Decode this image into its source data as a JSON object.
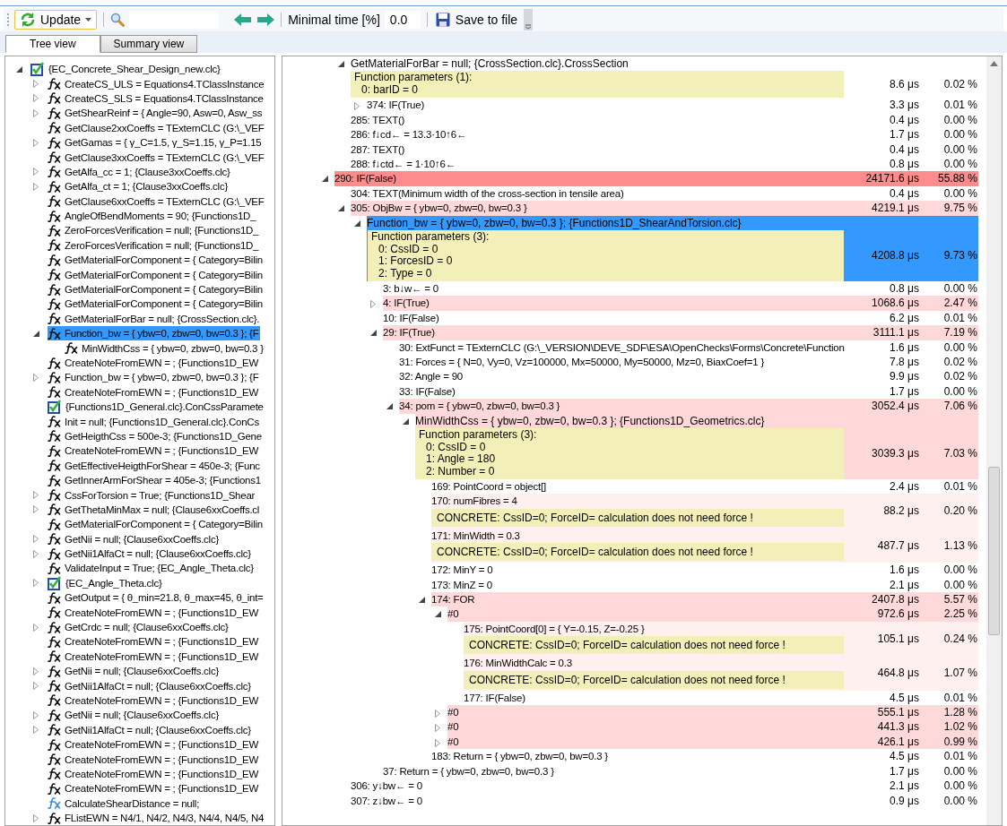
{
  "toolbar": {
    "update_button": {
      "label": "Update"
    },
    "min_time": {
      "label": "Minimal time [%]",
      "value": "0.0"
    },
    "save_button": {
      "label": "Save to file"
    }
  },
  "tabs": [
    {
      "label": "Tree view",
      "selected": true
    },
    {
      "label": "Summary view",
      "selected": false
    }
  ],
  "tree": {
    "items": [
      {
        "label": "{EC_Concrete_Shear_Design_new.clc}",
        "kind": "module",
        "expanded": true,
        "selected": false,
        "children": [
          {
            "label": "CreateCS_ULS = Equations4.TClassInstance",
            "kind": "function",
            "expanded": false,
            "selected": false
          },
          {
            "label": "CreateCS_SLS = Equations4.TClassInstance",
            "kind": "function",
            "expanded": false,
            "selected": false
          },
          {
            "label": "GetShearReinf = { Angle=90, Asw=0, Asw_ss",
            "kind": "function",
            "expanded": false,
            "selected": false
          },
          {
            "label": "GetClause2xxCoeffs = TExternCLC (G:\\_VEF",
            "kind": "function",
            "selected": false
          },
          {
            "label": "GetGamas = { γ_C=1.5, γ_S=1.15, γ_P=1.15",
            "kind": "function",
            "expanded": false,
            "selected": false
          },
          {
            "label": "GetClause3xxCoeffs = TExternCLC (G:\\_VEF",
            "kind": "function",
            "selected": false
          },
          {
            "label": "GetAlfa_cc = 1;  {Clause3xxCoeffs.clc}",
            "kind": "function",
            "expanded": false,
            "selected": false
          },
          {
            "label": "GetAlfa_ct = 1;  {Clause3xxCoeffs.clc}",
            "kind": "function",
            "expanded": false,
            "selected": false
          },
          {
            "label": "GetClause6xxCoeffs = TExternCLC (G:\\_VEF",
            "kind": "function",
            "selected": false
          },
          {
            "label": "AngleOfBendMoments = 90;  {Functions1D_",
            "kind": "function",
            "selected": false
          },
          {
            "label": "ZeroForcesVerification = null;  {Functions1D_",
            "kind": "function",
            "selected": false
          },
          {
            "label": "ZeroForcesVerification = null;  {Functions1D_",
            "kind": "function",
            "selected": false
          },
          {
            "label": "GetMaterialForComponent = { Category=Bilin",
            "kind": "function",
            "selected": false
          },
          {
            "label": "GetMaterialForComponent = { Category=Bilin",
            "kind": "function",
            "selected": false
          },
          {
            "label": "GetMaterialForComponent = { Category=Bilin",
            "kind": "function",
            "selected": false
          },
          {
            "label": "GetMaterialForComponent = { Category=Bilin",
            "kind": "function",
            "selected": false
          },
          {
            "label": "GetMaterialForBar = null;  {CrossSection.clc}.",
            "kind": "function",
            "selected": false
          },
          {
            "label": "Function_bw = { ybw=0, zbw=0, bw=0.3 };  {F",
            "kind": "function",
            "expanded": true,
            "selected": true,
            "children": [
              {
                "label": "MinWidthCss = { ybw=0, zbw=0, bw=0.3 }",
                "kind": "function",
                "selected": false
              }
            ]
          },
          {
            "label": "CreateNoteFromEWN = ;  {Functions1D_EW",
            "kind": "function",
            "selected": false
          },
          {
            "label": "Function_bw = { ybw=0, zbw=0, bw=0.3 };  {F",
            "kind": "function",
            "expanded": false,
            "selected": false
          },
          {
            "label": "CreateNoteFromEWN = ;  {Functions1D_EW",
            "kind": "function",
            "selected": false
          },
          {
            "label": "{Functions1D_General.clc}.ConCssParamete",
            "kind": "module",
            "selected": false
          },
          {
            "label": "Init = null;  {Functions1D_General.clc}.ConCs",
            "kind": "function",
            "selected": false
          },
          {
            "label": "GetHeigthCss = 500e-3;  {Functions1D_Gene",
            "kind": "function",
            "selected": false
          },
          {
            "label": "CreateNoteFromEWN = ;  {Functions1D_EW",
            "kind": "function",
            "selected": false
          },
          {
            "label": "GetEffectiveHeigthForShear = 450e-3;  {Func",
            "kind": "function",
            "selected": false
          },
          {
            "label": "GetInnerArmForShear = 405e-3;  {Functions1",
            "kind": "function",
            "selected": false
          },
          {
            "label": "CssForTorsion = True;  {Functions1D_Shear",
            "kind": "function",
            "expanded": false,
            "selected": false
          },
          {
            "label": "GetThetaMinMax = null;  {Clause6xxCoeffs.cl",
            "kind": "function",
            "expanded": false,
            "selected": false
          },
          {
            "label": "GetMaterialForComponent = { Category=Bilin",
            "kind": "function",
            "selected": false
          },
          {
            "label": "GetNii = null;  {Clause6xxCoeffs.clc}",
            "kind": "function",
            "expanded": false,
            "selected": false
          },
          {
            "label": "GetNii1AlfaCt = null;  {Clause6xxCoeffs.clc}",
            "kind": "function",
            "expanded": false,
            "selected": false
          },
          {
            "label": "ValidateInput = True;  {EC_Angle_Theta.clc}",
            "kind": "function",
            "selected": false
          },
          {
            "label": "{EC_Angle_Theta.clc}",
            "kind": "module",
            "expanded": false,
            "selected": false
          },
          {
            "label": "GetOutput = { θ_min=21.8, θ_max=45, θ_int=",
            "kind": "function",
            "selected": false
          },
          {
            "label": "CreateNoteFromEWN = ;  {Functions1D_EW",
            "kind": "function",
            "selected": false
          },
          {
            "label": "GetCrdc = null;  {Clause6xxCoeffs.clc}",
            "kind": "function",
            "expanded": false,
            "selected": false
          },
          {
            "label": "CreateNoteFromEWN = ;  {Functions1D_EW",
            "kind": "function",
            "selected": false
          },
          {
            "label": "CreateNoteFromEWN = ;  {Functions1D_EW",
            "kind": "function",
            "selected": false
          },
          {
            "label": "GetNii = null;  {Clause6xxCoeffs.clc}",
            "kind": "function",
            "expanded": false,
            "selected": false
          },
          {
            "label": "GetNii1AlfaCt = null;  {Clause6xxCoeffs.clc}",
            "kind": "function",
            "expanded": false,
            "selected": false
          },
          {
            "label": "CreateNoteFromEWN = ;  {Functions1D_EW",
            "kind": "function",
            "selected": false
          },
          {
            "label": "GetNii = null;  {Clause6xxCoeffs.clc}",
            "kind": "function",
            "expanded": false,
            "selected": false
          },
          {
            "label": "GetNii1AlfaCt = null;  {Clause6xxCoeffs.clc}",
            "kind": "function",
            "expanded": false,
            "selected": false
          },
          {
            "label": "CreateNoteFromEWN = ;  {Functions1D_EW",
            "kind": "function",
            "selected": false
          },
          {
            "label": "CreateNoteFromEWN = ;  {Functions1D_EW",
            "kind": "function",
            "selected": false
          },
          {
            "label": "CreateNoteFromEWN = ;  {Functions1D_EW",
            "kind": "function",
            "selected": false
          },
          {
            "label": "CreateNoteFromEWN = ;  {Functions1D_EW",
            "kind": "function",
            "selected": false
          },
          {
            "label": "CalculateShearDistance = null;",
            "kind": "function-light",
            "selected": false
          },
          {
            "label": "FListEWN = N4/1, N4/2, N4/3, N4/4, N4/5, N4",
            "kind": "function",
            "expanded": false,
            "selected": false
          }
        ]
      }
    ]
  },
  "profile": {
    "rows": [
      {
        "children": [
          {
            "text": "GetMaterialForBar = null;  {CrossSection.clc}.CrossSection",
            "color": "#ffffff",
            "selected": false,
            "expanded": true,
            "params": {
              "title": "Function parameters (1):",
              "items": [
                "0: barID = 0"
              ]
            },
            "time": "8.6 μs",
            "percent": "0.02 %",
            "children": [
              {
                "text": "374: IF(True)",
                "color": "#ffffff",
                "selected": false,
                "expanded": false,
                "time": "3.3 μs",
                "percent": "0.01 %"
              }
            ]
          },
          {
            "text": "285: TEXT()",
            "color": "#ffffff",
            "selected": false,
            "time": "0.4 μs",
            "percent": "0.00 %"
          },
          {
            "text": "286: f↓cd← = 13.3·10↑6←",
            "color": "#ffffff",
            "selected": false,
            "time": "1.7 μs",
            "percent": "0.00 %"
          },
          {
            "text": "287: TEXT()",
            "color": "#ffffff",
            "selected": false,
            "time": "0.4 μs",
            "percent": "0.00 %"
          },
          {
            "text": "288: f↓ctd← = 1·10↑6←",
            "color": "#ffffff",
            "selected": false,
            "time": "0.8 μs",
            "percent": "0.00 %"
          }
        ]
      },
      {
        "text": "290: IF(False)",
        "color": "#ff8c8c",
        "selected": false,
        "expanded": true,
        "time": "24171.6 μs",
        "percent": "55.88 %",
        "children": [
          {
            "text": "304: TEXT(Minimum width of the cross-section in tensile area)",
            "color": "#ffffff",
            "selected": false,
            "time": "0.4 μs",
            "percent": "0.00 %"
          },
          {
            "text": "305: ObjBw = { ybw=0, zbw=0, bw=0.3 }",
            "color": "#ffd9d9",
            "selected": false,
            "expanded": true,
            "time": "4219.1 μs",
            "percent": "9.75 %",
            "children": [
              {
                "text": "Function_bw = { ybw=0, zbw=0, bw=0.3 };  {Functions1D_ShearAndTorsion.clc}",
                "selected": true,
                "expanded": true,
                "params": {
                  "title": "Function parameters (3):",
                  "items": [
                    "0: CssID = 0",
                    "1: ForcesID = 0",
                    "2: Type = 0"
                  ]
                },
                "time": "4208.8 μs",
                "percent": "9.73 %",
                "children": [
                  {
                    "text": "3: b↓w← = 0",
                    "color": "#ffffff",
                    "selected": false,
                    "time": "0.8 μs",
                    "percent": "0.00 %"
                  },
                  {
                    "text": "4: IF(True)",
                    "color": "#ffd9d9",
                    "selected": false,
                    "expanded": false,
                    "time": "1068.6 μs",
                    "percent": "2.47 %"
                  },
                  {
                    "text": "10: IF(False)",
                    "color": "#ffffff",
                    "selected": false,
                    "time": "6.2 μs",
                    "percent": "0.01 %"
                  },
                  {
                    "text": "29: IF(True)",
                    "color": "#ffd9d9",
                    "selected": false,
                    "expanded": true,
                    "time": "3111.1 μs",
                    "percent": "7.19 %",
                    "children": [
                      {
                        "text": "30: ExtFunct = TExternCLC (G:\\_VERSION\\DEVE_SDF\\ESA\\OpenChecks\\Forms\\Concrete\\Function",
                        "color": "#ffffff",
                        "selected": false,
                        "time": "1.6 μs",
                        "percent": "0.00 %"
                      },
                      {
                        "text": "31: Forces = { N=0, Vy=0, Vz=100000, Mx=50000, My=50000, Mz=0, BiaxCoef=1 }",
                        "color": "#ffffff",
                        "selected": false,
                        "time": "7.8 μs",
                        "percent": "0.02 %"
                      },
                      {
                        "text": "32: Angle = 90",
                        "color": "#ffffff",
                        "selected": false,
                        "time": "9.9 μs",
                        "percent": "0.02 %"
                      },
                      {
                        "text": "33: IF(False)",
                        "color": "#ffffff",
                        "selected": false,
                        "time": "1.7 μs",
                        "percent": "0.00 %"
                      },
                      {
                        "text": "34: pom = { ybw=0, zbw=0, bw=0.3 }",
                        "color": "#ffd9d9",
                        "selected": false,
                        "expanded": true,
                        "time": "3052.4 μs",
                        "percent": "7.06 %",
                        "children": [
                          {
                            "text": "MinWidthCss = { ybw=0, zbw=0, bw=0.3 };  {Functions1D_Geometrics.clc}",
                            "color": "#ffd9d9",
                            "selected": false,
                            "expanded": true,
                            "params": {
                              "title": "Function parameters (3):",
                              "items": [
                                "0: CssID = 0",
                                "1: Angle = 180",
                                "2: Number = 0"
                              ]
                            },
                            "time": "3039.3 μs",
                            "percent": "7.03 %",
                            "children": [
                              {
                                "text": "169: PointCoord = object[]",
                                "color": "#ffffff",
                                "selected": false,
                                "time": "2.4 μs",
                                "percent": "0.01 %"
                              },
                              {
                                "text": "170: numFibres = 4",
                                "color": "#fff0f0",
                                "selected": false,
                                "note": "CONCRETE: CssID=0; ForceID= calculation does not need force !",
                                "time": "88.2 μs",
                                "percent": "0.20 %"
                              },
                              {
                                "text": "171: MinWidth = 0.3",
                                "color": "#fff0f0",
                                "selected": false,
                                "note": "CONCRETE: CssID=0; ForceID= calculation does not need force !",
                                "time": "487.7 μs",
                                "percent": "1.13 %"
                              },
                              {
                                "text": "172: MinY = 0",
                                "color": "#ffffff",
                                "selected": false,
                                "time": "1.6 μs",
                                "percent": "0.00 %"
                              },
                              {
                                "text": "173: MinZ = 0",
                                "color": "#ffffff",
                                "selected": false,
                                "time": "2.1 μs",
                                "percent": "0.00 %"
                              },
                              {
                                "text": "174: FOR",
                                "color": "#ffd9d9",
                                "selected": false,
                                "expanded": true,
                                "time": "2407.8 μs",
                                "percent": "5.57 %",
                                "children": [
                                  {
                                    "text": "#0",
                                    "color": "#ffd9d9",
                                    "selected": false,
                                    "expanded": true,
                                    "time": "972.6 μs",
                                    "percent": "2.25 %",
                                    "children": [
                                      {
                                        "text": "175: PointCoord[0] = { Y=-0.15, Z=-0.25 }",
                                        "color": "#fff0f0",
                                        "selected": false,
                                        "note": "CONCRETE: CssID=0; ForceID= calculation does not need force !",
                                        "time": "105.1 μs",
                                        "percent": "0.24 %"
                                      },
                                      {
                                        "text": "176: MinWidthCalc = 0.3",
                                        "color": "#fff0f0",
                                        "selected": false,
                                        "note": "CONCRETE: CssID=0; ForceID= calculation does not need force !",
                                        "time": "464.8 μs",
                                        "percent": "1.07 %"
                                      },
                                      {
                                        "text": "177: IF(False)",
                                        "color": "#ffffff",
                                        "selected": false,
                                        "time": "4.5 μs",
                                        "percent": "0.01 %"
                                      }
                                    ]
                                  },
                                  {
                                    "text": "#0",
                                    "color": "#ffd9d9",
                                    "selected": false,
                                    "expanded": false,
                                    "time": "555.1 μs",
                                    "percent": "1.28 %"
                                  },
                                  {
                                    "text": "#0",
                                    "color": "#ffd9d9",
                                    "selected": false,
                                    "expanded": false,
                                    "time": "441.3 μs",
                                    "percent": "1.02 %"
                                  },
                                  {
                                    "text": "#0",
                                    "color": "#ffd9d9",
                                    "selected": false,
                                    "expanded": false,
                                    "time": "426.1 μs",
                                    "percent": "0.99 %"
                                  }
                                ]
                              },
                              {
                                "text": "183: Return = { ybw=0, zbw=0, bw=0.3 }",
                                "color": "#ffffff",
                                "selected": false,
                                "time": "4.5 μs",
                                "percent": "0.01 %"
                              }
                            ]
                          }
                        ]
                      }
                    ]
                  },
                  {
                    "text": "37: Return = { ybw=0, zbw=0, bw=0.3 }",
                    "color": "#ffffff",
                    "selected": false,
                    "time": "1.7 μs",
                    "percent": "0.00 %"
                  }
                ]
              }
            ]
          },
          {
            "text": "306: y↓bw← = 0",
            "color": "#ffffff",
            "selected": false,
            "time": "2.1 μs",
            "percent": "0.00 %"
          },
          {
            "text": "307: z↓bw← = 0",
            "color": "#ffffff",
            "selected": false,
            "time": "0.9 μs",
            "percent": "0.00 %"
          }
        ]
      }
    ]
  }
}
